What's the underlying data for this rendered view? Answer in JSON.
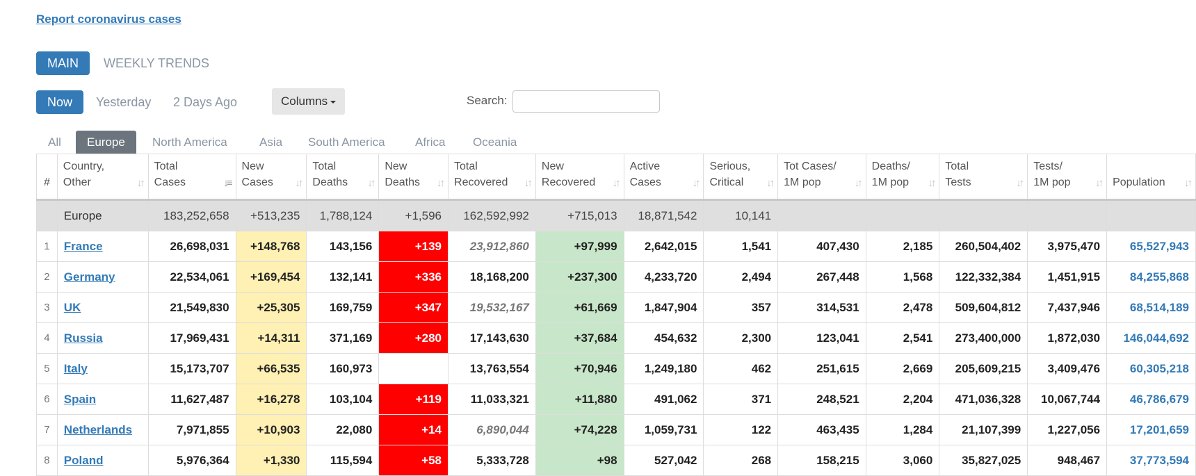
{
  "report_link": "Report coronavirus cases",
  "view_tabs": {
    "main": "MAIN",
    "weekly": "WEEKLY TRENDS"
  },
  "day_tabs": {
    "now": "Now",
    "yesterday": "Yesterday",
    "two_days": "2 Days Ago"
  },
  "columns_button": "Columns",
  "search": {
    "label": "Search:",
    "placeholder": ""
  },
  "region_tabs": [
    "All",
    "Europe",
    "North America",
    "Asia",
    "South America",
    "Africa",
    "Oceania"
  ],
  "active_region": "Europe",
  "table": {
    "headers": [
      {
        "line1": "#",
        "line2": ""
      },
      {
        "line1": "Country,",
        "line2": "Other"
      },
      {
        "line1": "Total",
        "line2": "Cases"
      },
      {
        "line1": "New",
        "line2": "Cases"
      },
      {
        "line1": "Total",
        "line2": "Deaths"
      },
      {
        "line1": "New",
        "line2": "Deaths"
      },
      {
        "line1": "Total",
        "line2": "Recovered"
      },
      {
        "line1": "New",
        "line2": "Recovered"
      },
      {
        "line1": "Active",
        "line2": "Cases"
      },
      {
        "line1": "Serious,",
        "line2": "Critical"
      },
      {
        "line1": "Tot Cases/",
        "line2": "1M pop"
      },
      {
        "line1": "Deaths/",
        "line2": "1M pop"
      },
      {
        "line1": "Total",
        "line2": "Tests"
      },
      {
        "line1": "Tests/",
        "line2": "1M pop"
      },
      {
        "line1": "",
        "line2": "Population"
      }
    ],
    "total_row": {
      "country": "Europe",
      "total_cases": "183,252,658",
      "new_cases": "+513,235",
      "total_deaths": "1,788,124",
      "new_deaths": "+1,596",
      "total_recovered": "162,592,992",
      "new_recovered": "+715,013",
      "active_cases": "18,871,542",
      "serious": "10,141"
    },
    "rows": [
      {
        "num": "1",
        "country": "France",
        "total_cases": "26,698,031",
        "new_cases": "+148,768",
        "total_deaths": "143,156",
        "new_deaths": "+139",
        "total_recovered": "23,912,860",
        "new_recovered": "+97,999",
        "active_cases": "2,642,015",
        "serious": "1,541",
        "cases_per_m": "407,430",
        "deaths_per_m": "2,185",
        "total_tests": "260,504,402",
        "tests_per_m": "3,975,470",
        "population": "65,527,943"
      },
      {
        "num": "2",
        "country": "Germany",
        "total_cases": "22,534,061",
        "new_cases": "+169,454",
        "total_deaths": "132,141",
        "new_deaths": "+336",
        "total_recovered": "18,168,200",
        "new_recovered": "+237,300",
        "active_cases": "4,233,720",
        "serious": "2,494",
        "cases_per_m": "267,448",
        "deaths_per_m": "1,568",
        "total_tests": "122,332,384",
        "tests_per_m": "1,451,915",
        "population": "84,255,868"
      },
      {
        "num": "3",
        "country": "UK",
        "total_cases": "21,549,830",
        "new_cases": "+25,305",
        "total_deaths": "169,759",
        "new_deaths": "+347",
        "total_recovered": "19,532,167",
        "new_recovered": "+61,669",
        "active_cases": "1,847,904",
        "serious": "357",
        "cases_per_m": "314,531",
        "deaths_per_m": "2,478",
        "total_tests": "509,604,812",
        "tests_per_m": "7,437,946",
        "population": "68,514,189"
      },
      {
        "num": "4",
        "country": "Russia",
        "total_cases": "17,969,431",
        "new_cases": "+14,311",
        "total_deaths": "371,169",
        "new_deaths": "+280",
        "total_recovered": "17,143,630",
        "new_recovered": "+37,684",
        "active_cases": "454,632",
        "serious": "2,300",
        "cases_per_m": "123,041",
        "deaths_per_m": "2,541",
        "total_tests": "273,400,000",
        "tests_per_m": "1,872,030",
        "population": "146,044,692"
      },
      {
        "num": "5",
        "country": "Italy",
        "total_cases": "15,173,707",
        "new_cases": "+66,535",
        "total_deaths": "160,973",
        "new_deaths": "",
        "total_recovered": "13,763,554",
        "new_recovered": "+70,946",
        "active_cases": "1,249,180",
        "serious": "462",
        "cases_per_m": "251,615",
        "deaths_per_m": "2,669",
        "total_tests": "205,609,215",
        "tests_per_m": "3,409,476",
        "population": "60,305,218"
      },
      {
        "num": "6",
        "country": "Spain",
        "total_cases": "11,627,487",
        "new_cases": "+16,278",
        "total_deaths": "103,104",
        "new_deaths": "+119",
        "total_recovered": "11,033,321",
        "new_recovered": "+11,880",
        "active_cases": "491,062",
        "serious": "371",
        "cases_per_m": "248,521",
        "deaths_per_m": "2,204",
        "total_tests": "471,036,328",
        "tests_per_m": "10,067,744",
        "population": "46,786,679"
      },
      {
        "num": "7",
        "country": "Netherlands",
        "total_cases": "7,971,855",
        "new_cases": "+10,903",
        "total_deaths": "22,080",
        "new_deaths": "+14",
        "total_recovered": "6,890,044",
        "new_recovered": "+74,228",
        "active_cases": "1,059,731",
        "serious": "122",
        "cases_per_m": "463,435",
        "deaths_per_m": "1,284",
        "total_tests": "21,107,399",
        "tests_per_m": "1,227,056",
        "population": "17,201,659"
      },
      {
        "num": "8",
        "country": "Poland",
        "total_cases": "5,976,364",
        "new_cases": "+1,330",
        "total_deaths": "115,594",
        "new_deaths": "+58",
        "total_recovered": "5,333,728",
        "new_recovered": "+98",
        "active_cases": "527,042",
        "serious": "268",
        "cases_per_m": "158,215",
        "deaths_per_m": "3,060",
        "total_tests": "35,827,025",
        "tests_per_m": "948,467",
        "population": "37,773,594"
      }
    ],
    "italic_recovered_rows": [
      "France",
      "UK",
      "Netherlands"
    ]
  },
  "colors": {
    "link": "#337ab7",
    "active_pill": "#337ab7",
    "active_region": "#6c757d",
    "new_cases_bg": "#fff0b3",
    "new_deaths_bg": "#ff0000",
    "new_recovered_bg": "#c8e6c9",
    "total_row_bg": "#dfdfdf"
  },
  "icons": {
    "sort": "sort-arrows-icon",
    "sort_active": "sort-desc-icon",
    "dropdown": "caret-down-icon"
  }
}
